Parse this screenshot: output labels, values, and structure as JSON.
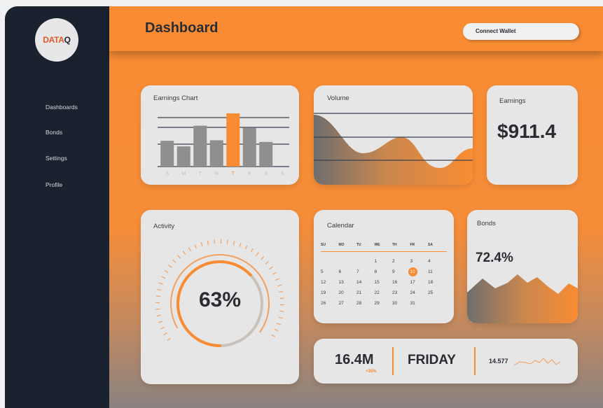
{
  "brand": {
    "logo_text": "DATA",
    "logo_q": "Q"
  },
  "sidebar": {
    "items": [
      {
        "label": "Dashboards"
      },
      {
        "label": "Bonds"
      },
      {
        "label": "Settings"
      },
      {
        "label": "Profile"
      }
    ]
  },
  "header": {
    "title": "Dashboard",
    "wallet_label": "Connect Wallet"
  },
  "earnings_chart": {
    "title": "Earnings Chart",
    "chart_data": {
      "type": "bar",
      "categories": [
        "S",
        "M",
        "T",
        "W",
        "T",
        "F",
        "S",
        "S"
      ],
      "values": [
        46,
        36,
        73,
        47,
        95,
        69,
        44
      ],
      "highlight_index": 4,
      "highlight_color": "#f98c33",
      "bar_color": "#8f8f8f"
    }
  },
  "volume": {
    "title": "Volume"
  },
  "earnings": {
    "title": "Earnings",
    "value": "$911.4"
  },
  "activity": {
    "title": "Activity",
    "value": "63%",
    "percent": 63
  },
  "calendar": {
    "title": "Calendar",
    "days": [
      "SU",
      "MO",
      "TU",
      "WE",
      "TH",
      "FR",
      "SA"
    ],
    "weeks": [
      [
        "",
        "",
        "",
        "1",
        "2",
        "3",
        "4"
      ],
      [
        "5",
        "6",
        "7",
        "8",
        "9",
        "10",
        "11"
      ],
      [
        "12",
        "13",
        "14",
        "15",
        "16",
        "17",
        "18"
      ],
      [
        "19",
        "20",
        "21",
        "22",
        "23",
        "24",
        "25"
      ],
      [
        "26",
        "27",
        "28",
        "29",
        "30",
        "31",
        ""
      ]
    ],
    "highlight_day": "10"
  },
  "bonds": {
    "title": "Bonds",
    "value": "72.4%"
  },
  "stats": {
    "value": "16.4M",
    "change": "+35%",
    "day": "FRIDAY",
    "small_value": "14.577"
  },
  "colors": {
    "accent": "#f98c33",
    "sidebar": "#1a2230",
    "card": "#e6e6e6",
    "text": "#2a2c33"
  }
}
